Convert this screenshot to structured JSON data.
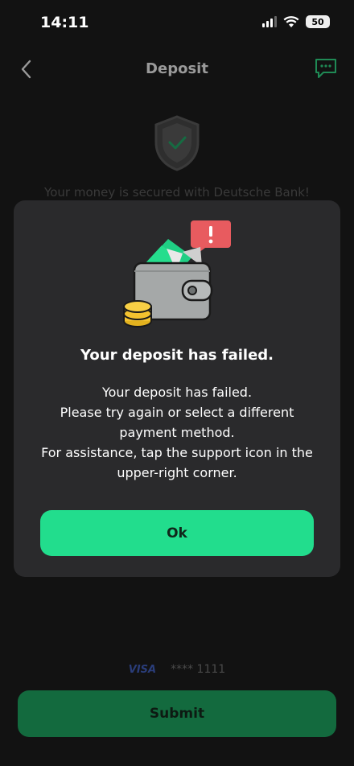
{
  "status_bar": {
    "time": "14:11",
    "battery": "50"
  },
  "header": {
    "title": "Deposit",
    "back_icon": "chevron-left-icon",
    "support_icon": "chat-bubble-icon"
  },
  "background": {
    "secured_text": "Your money is secured with Deutsche Bank!",
    "card_brand": "VISA",
    "card_number": "**** 1111",
    "submit_label": "Submit"
  },
  "modal": {
    "title": "Your deposit has failed.",
    "body_lines": [
      "Your deposit has failed.",
      "Please try again or select a different",
      "payment method.",
      "For assistance, tap the support icon in the",
      "upper-right corner."
    ],
    "ok_label": "Ok",
    "illustration_icon": "wallet-error-icon"
  },
  "colors": {
    "accent": "#22dd8d",
    "submit_bg": "#136a3e",
    "alert": "#e85b5f"
  }
}
